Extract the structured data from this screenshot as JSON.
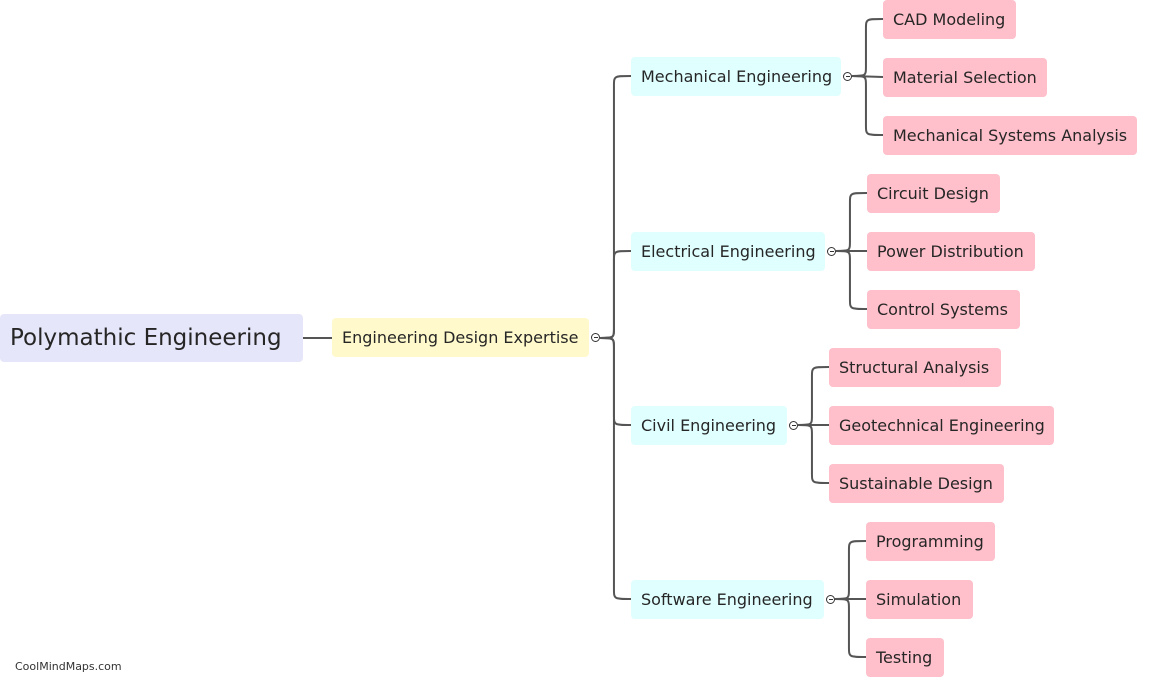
{
  "mindmap": {
    "root": {
      "label": "Polymathic Engineering"
    },
    "level1": {
      "label": "Engineering Design Expertise"
    },
    "branches": [
      {
        "label": "Mechanical Engineering",
        "children": [
          "CAD Modeling",
          "Material Selection",
          "Mechanical Systems Analysis"
        ]
      },
      {
        "label": "Electrical Engineering",
        "children": [
          "Circuit Design",
          "Power Distribution",
          "Control Systems"
        ]
      },
      {
        "label": "Civil Engineering",
        "children": [
          "Structural Analysis",
          "Geotechnical Engineering",
          "Sustainable Design"
        ]
      },
      {
        "label": "Software Engineering",
        "children": [
          "Programming",
          "Simulation",
          "Testing"
        ]
      }
    ]
  },
  "colors": {
    "root": "#e6e6fa",
    "level1": "#fff9cc",
    "level2": "#e0ffff",
    "level3": "#ffc0cb",
    "link": "#555555"
  },
  "watermark": "CoolMindMaps.com"
}
